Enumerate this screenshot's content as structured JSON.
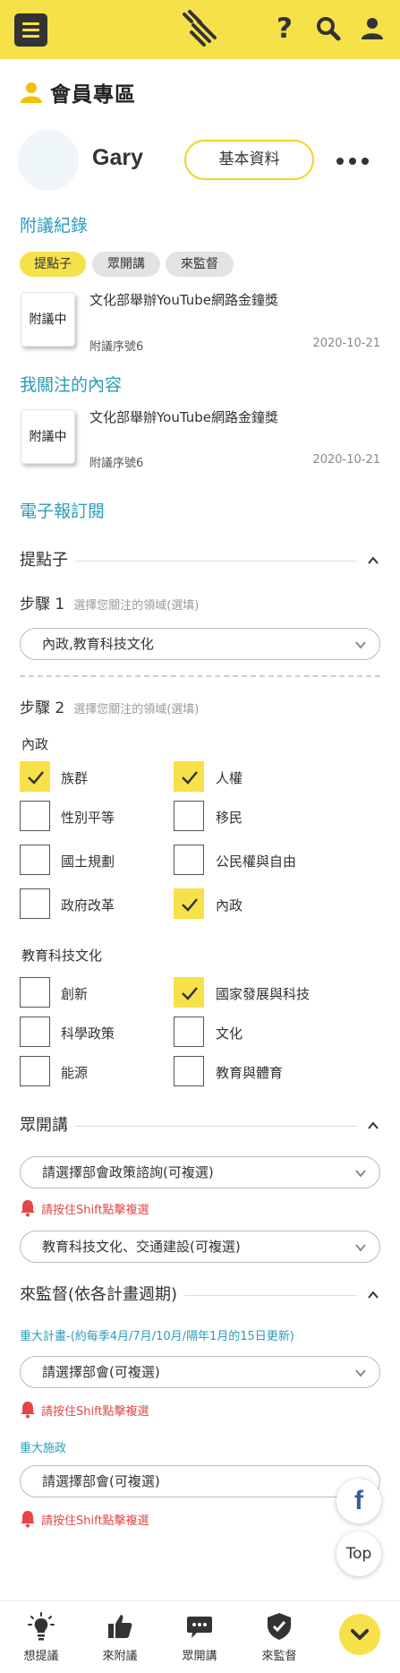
{
  "header": {
    "help_icon": "?",
    "brand_color": "#f7e14b"
  },
  "member": {
    "title": "會員專區",
    "username": "Gary",
    "profile_button": "基本資料"
  },
  "records": {
    "title": "附議紀錄",
    "chips": [
      "提點子",
      "眾開講",
      "來監督"
    ],
    "item": {
      "stamp": "附議中",
      "title": "文化部舉辦YouTube網路金鐘獎",
      "serial": "附議序號6",
      "date": "2020-10-21"
    }
  },
  "followed": {
    "title": "我關注的內容",
    "item": {
      "stamp": "附議中",
      "title": "文化部舉辦YouTube網路金鐘獎",
      "serial": "附議序號6",
      "date": "2020-10-21"
    }
  },
  "newsletter": {
    "title": "電子報訂閱",
    "idea": {
      "title": "提點子",
      "step1": {
        "label": "步驟 1",
        "hint": "選擇您關注的領域(選填)",
        "value": "內政,教育科技文化"
      },
      "step2": {
        "label": "步驟 2",
        "hint": "選擇您關注的領域(選填)"
      },
      "groups": [
        {
          "label": "內政",
          "options": [
            {
              "label": "族群",
              "checked": true
            },
            {
              "label": "人權",
              "checked": true
            },
            {
              "label": "性別平等",
              "checked": false
            },
            {
              "label": "移民",
              "checked": false
            },
            {
              "label": "國土規劃",
              "checked": false
            },
            {
              "label": "公民權與自由",
              "checked": false
            },
            {
              "label": "政府改革",
              "checked": false
            },
            {
              "label": "內政",
              "checked": true
            }
          ]
        },
        {
          "label": "教育科技文化",
          "options": [
            {
              "label": "創新",
              "checked": false
            },
            {
              "label": "國家發展與科技",
              "checked": true
            },
            {
              "label": "科學政策",
              "checked": false
            },
            {
              "label": "文化",
              "checked": false
            },
            {
              "label": "能源",
              "checked": false
            },
            {
              "label": "教育與體育",
              "checked": false
            }
          ]
        }
      ]
    },
    "talk": {
      "title": "眾開講",
      "select1": "請選擇部會政策諮詢(可複選)",
      "warning": "請按住Shift點擊複選",
      "select2": "教育科技文化、交通建設(可複選)"
    },
    "supervise": {
      "title": "來監督(依各計畫週期)",
      "note1": "重大計畫-(約每季4月/7月/10月/隔年1月的15日更新)",
      "select1": "請選擇部會(可複選)",
      "warning1": "請按住Shift點擊複選",
      "note2": "重大施政",
      "select2": "請選擇部會(可複選)",
      "warning2": "請按住Shift點擊複選"
    }
  },
  "fab": {
    "facebook": "f",
    "top": "Top"
  },
  "bottom_nav": [
    "想提議",
    "來附議",
    "眾開講",
    "來監督"
  ]
}
